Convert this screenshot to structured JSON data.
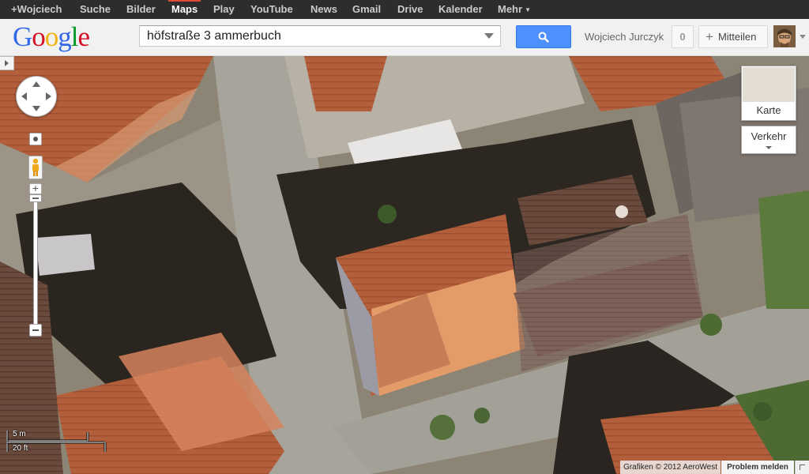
{
  "topbar": {
    "links": [
      "+Wojciech",
      "Suche",
      "Bilder",
      "Maps",
      "Play",
      "YouTube",
      "News",
      "Gmail",
      "Drive",
      "Kalender",
      "Mehr"
    ],
    "active": "Maps"
  },
  "header": {
    "logo": "Google",
    "search_value": "höfstraße 3 ammerbuch",
    "user_name": "Wojciech Jurczyk",
    "notification_count": "0",
    "share_label": "Mitteilen"
  },
  "map": {
    "mode": "satellite",
    "maptype_button_label": "Karte",
    "traffic_button_label": "Verkehr",
    "scale_metric": "5 m",
    "scale_imperial": "20 ft",
    "attribution": "Grafiken © 2012 AeroWest",
    "report_problem": "Problem melden"
  },
  "colors": {
    "topbar_bg": "#2d2d2d",
    "search_blue": "#4d90fe",
    "active_red": "#dd4b39"
  },
  "icons": [
    "search-icon",
    "pegman-icon",
    "plus-icon",
    "chevron-down-icon",
    "pan-arrows-icon"
  ]
}
